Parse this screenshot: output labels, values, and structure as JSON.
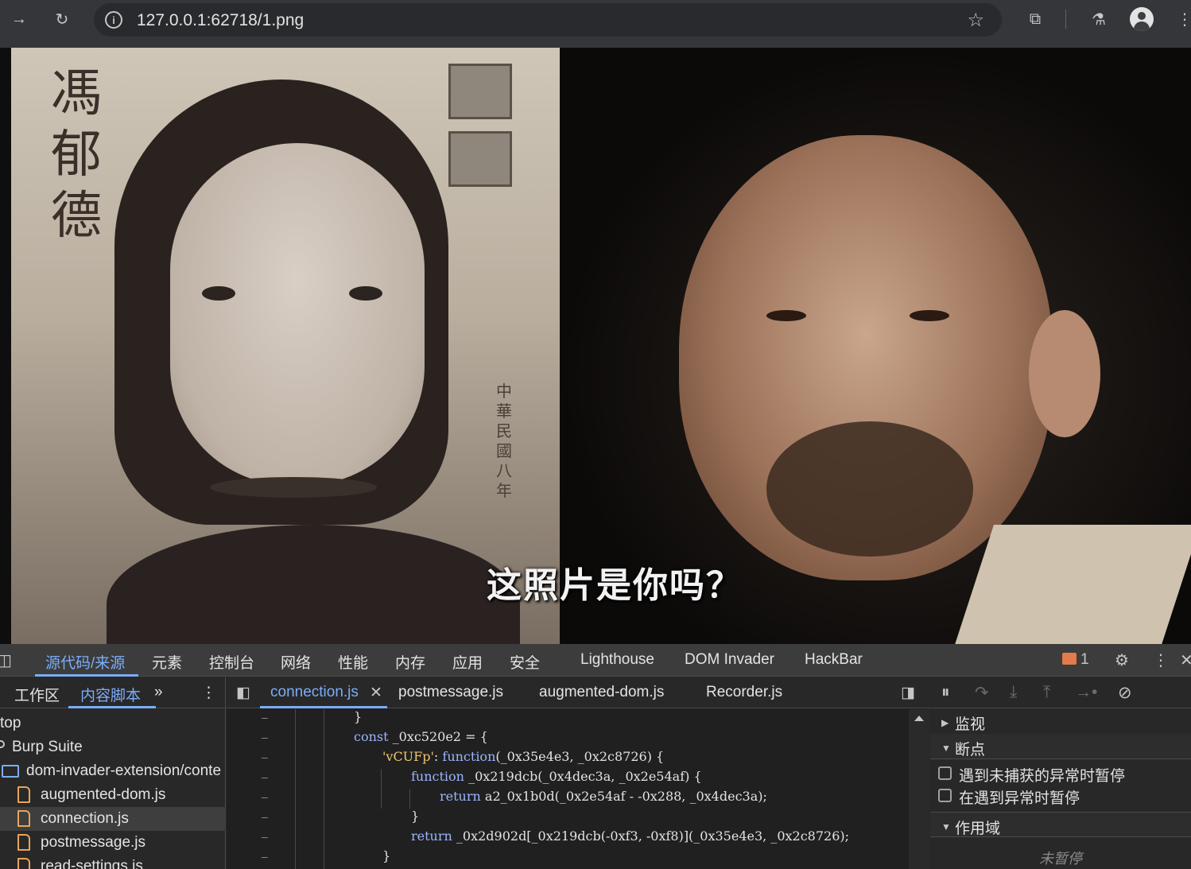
{
  "browser": {
    "url": "127.0.0.1:62718/1.png",
    "icons": [
      "forward-icon",
      "reload-icon",
      "site-info-icon",
      "bookmark-star-icon",
      "extensions-icon",
      "labs-flask-icon",
      "profile-icon",
      "menu-kebab-icon"
    ]
  },
  "viewport": {
    "subtitle": "这照片是你吗？",
    "left_photo_calligraphy": "馮郁德",
    "left_photo_stamp_text": "中華民國八年"
  },
  "devtools": {
    "tabs": [
      {
        "label": "源代码/来源",
        "active": true
      },
      {
        "label": "元素"
      },
      {
        "label": "控制台"
      },
      {
        "label": "网络"
      },
      {
        "label": "性能"
      },
      {
        "label": "内存"
      },
      {
        "label": "应用"
      },
      {
        "label": "安全"
      },
      {
        "label": "Lighthouse"
      },
      {
        "label": "DOM Invader"
      },
      {
        "label": "HackBar"
      }
    ],
    "issues_count": "1",
    "navigator": {
      "tabs": [
        {
          "label": "工作区"
        },
        {
          "label": "内容脚本",
          "active": true
        }
      ],
      "tree": [
        {
          "label": "top",
          "type": "frame"
        },
        {
          "label": "Burp Suite",
          "type": "extension"
        },
        {
          "label": "dom-invader-extension/conte",
          "type": "folder"
        },
        {
          "label": "augmented-dom.js",
          "type": "file"
        },
        {
          "label": "connection.js",
          "type": "file",
          "selected": true
        },
        {
          "label": "postmessage.js",
          "type": "file"
        },
        {
          "label": "read-settings.js",
          "type": "file"
        }
      ]
    },
    "editor": {
      "tabs": [
        {
          "label": "connection.js",
          "active": true,
          "closable": true
        },
        {
          "label": "postmessage.js"
        },
        {
          "label": "augmented-dom.js"
        },
        {
          "label": "Recorder.js"
        }
      ],
      "gutter_marks": [
        "–",
        "–",
        "–",
        "–",
        "–",
        "–",
        "–",
        "–"
      ],
      "code_lines": [
        "}",
        "const _0xc520e2 = {",
        "'vCUFp': function(_0x35e4e3, _0x2c8726) {",
        "function _0x219dcb(_0x4dec3a, _0x2e54af) {",
        "return a2_0x1b0d(_0x2e54af - -0x288, _0x4dec3a);",
        "}",
        "return _0x2d902d[_0x219dcb(-0xf3, -0xf8)](_0x35e4e3, _0x2c8726);",
        "}"
      ]
    },
    "debugger": {
      "sections": {
        "watch": "监视",
        "breakpoints": "断点",
        "scope": "作用域"
      },
      "options": {
        "pause_uncaught": "遇到未捕获的异常时暂停",
        "pause_caught": "在遇到异常时暂停"
      },
      "status": "未暂停"
    }
  }
}
